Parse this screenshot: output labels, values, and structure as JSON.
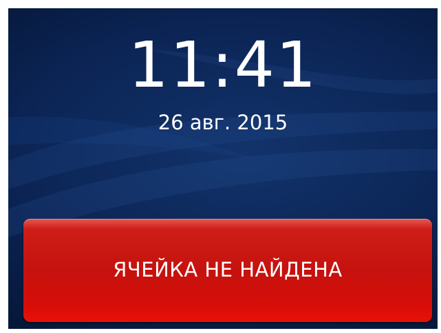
{
  "lock_screen": {
    "time": "11:41",
    "date": "26 авг. 2015"
  },
  "alert": {
    "label": "ЯЧЕЙКА НЕ НАЙДЕНА",
    "color": "#cc1410"
  },
  "theme": {
    "background_color": "#0b2454"
  }
}
